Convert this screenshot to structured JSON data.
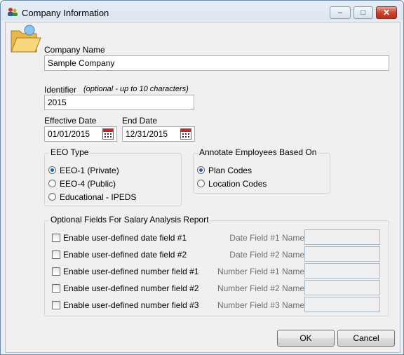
{
  "window": {
    "title": "Company Information"
  },
  "icons": {
    "app": "app-people-icon",
    "folder": "folder-open-icon",
    "calendar": "calendar-icon"
  },
  "company": {
    "name_label": "Company Name",
    "name_value": "Sample Company"
  },
  "identifier": {
    "label": "Identifier",
    "hint": "(optional - up to 10 characters)",
    "value": "2015"
  },
  "effective_date": {
    "label": "Effective Date",
    "value": "01/01/2015"
  },
  "end_date": {
    "label": "End Date",
    "value": "12/31/2015"
  },
  "eeo": {
    "legend": "EEO Type",
    "options": [
      {
        "label": "EEO-1 (Private)",
        "selected": true
      },
      {
        "label": "EEO-4 (Public)",
        "selected": false
      },
      {
        "label": "Educational - IPEDS",
        "selected": false
      }
    ]
  },
  "annotate": {
    "legend": "Annotate Employees Based On",
    "options": [
      {
        "label": "Plan Codes",
        "selected": true
      },
      {
        "label": "Location Codes",
        "selected": false
      }
    ]
  },
  "optional_fields": {
    "legend": "Optional Fields For Salary Analysis Report",
    "rows": [
      {
        "checkbox_label": "Enable user-defined date field #1",
        "field_label": "Date Field #1 Name",
        "value": ""
      },
      {
        "checkbox_label": "Enable user-defined date field #2",
        "field_label": "Date Field #2 Name",
        "value": ""
      },
      {
        "checkbox_label": "Enable user-defined number field #1",
        "field_label": "Number Field #1 Name",
        "value": ""
      },
      {
        "checkbox_label": "Enable user-defined number field #2",
        "field_label": "Number Field #2 Name",
        "value": ""
      },
      {
        "checkbox_label": "Enable user-defined number field #3",
        "field_label": "Number Field #3 Name",
        "value": ""
      }
    ]
  },
  "buttons": {
    "ok": "OK",
    "cancel": "Cancel"
  },
  "colors": {
    "radio_selected": "#1f5fad",
    "close_button": "#c9452f",
    "calendar_red": "#c0282c"
  }
}
